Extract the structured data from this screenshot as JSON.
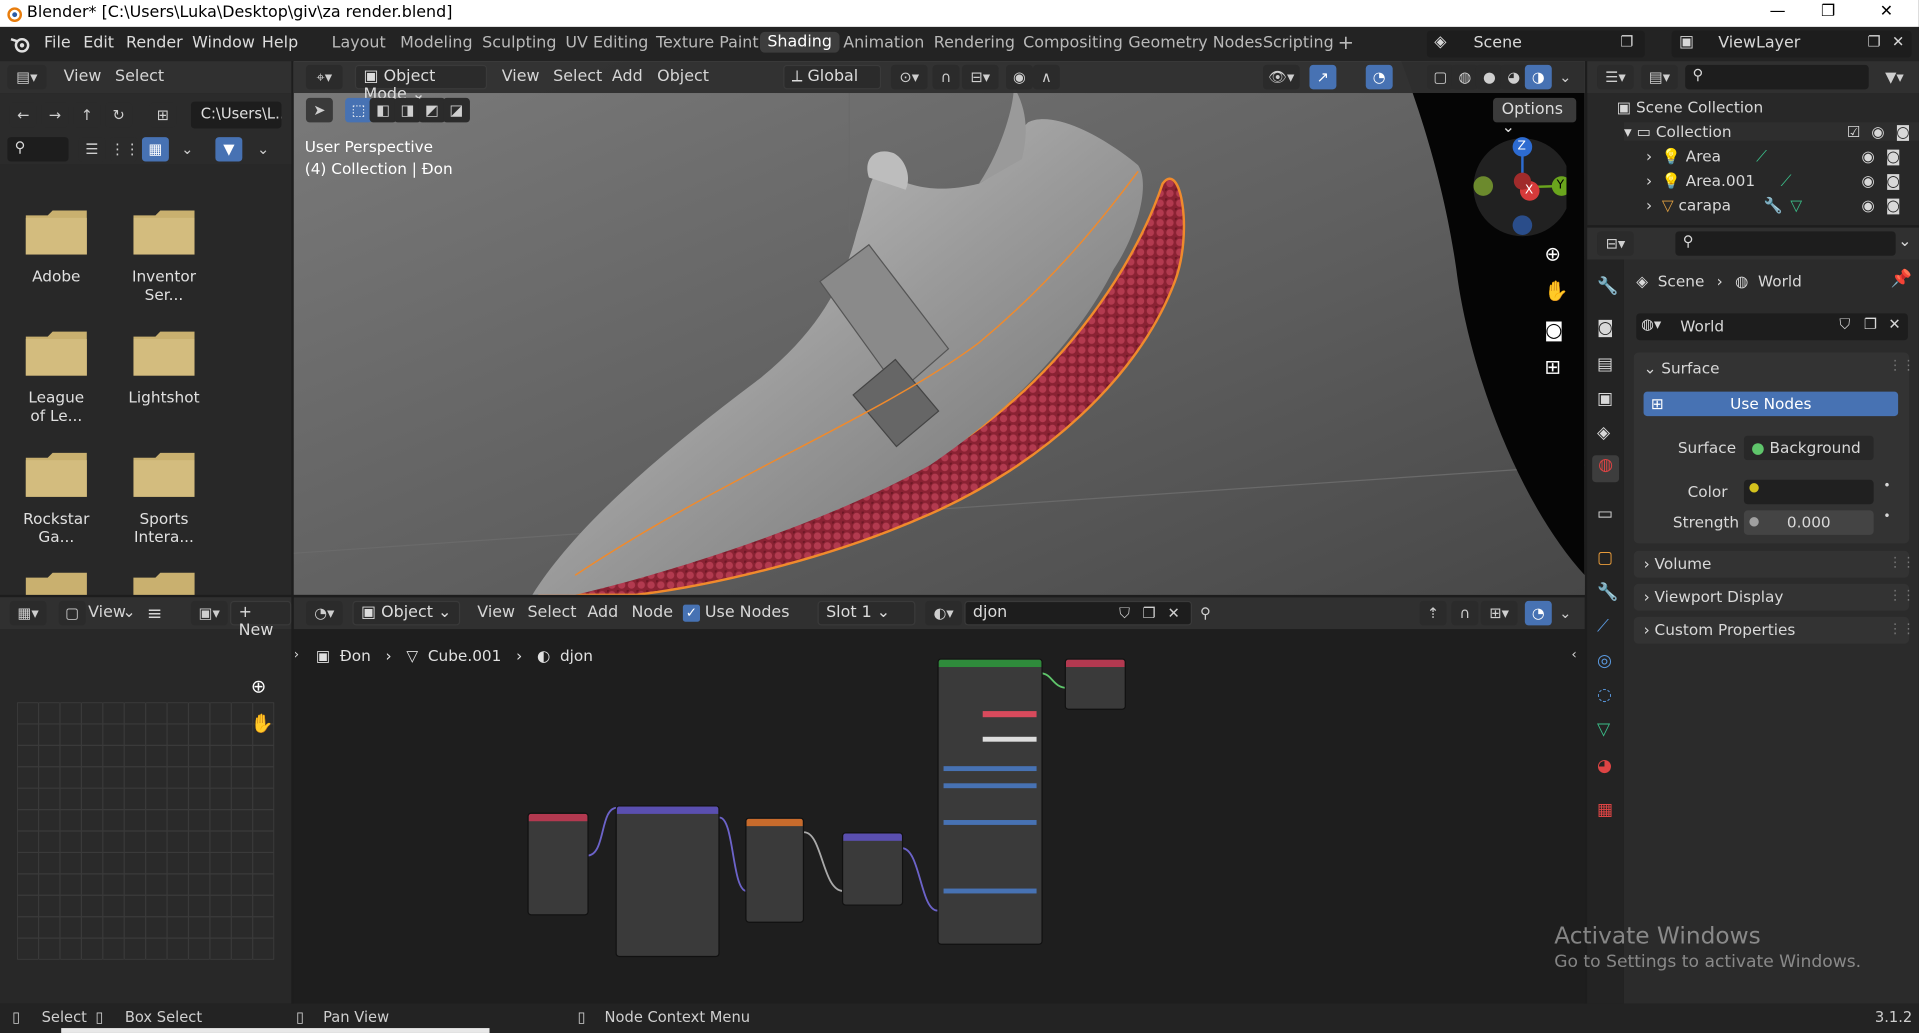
{
  "window": {
    "title": "Blender* [C:\\Users\\Luka\\Desktop\\giv\\za render.blend]",
    "min": "—",
    "max": "❐",
    "close": "✕"
  },
  "menu": [
    "File",
    "Edit",
    "Render",
    "Window",
    "Help"
  ],
  "workspaces": [
    "Layout",
    "Modeling",
    "Sculpting",
    "UV Editing",
    "Texture Paint",
    "Shading",
    "Animation",
    "Rendering",
    "Compositing",
    "Geometry Nodes",
    "Scripting"
  ],
  "active_workspace": "Shading",
  "add_workspace": "+",
  "scene": {
    "name": "Scene",
    "view_layer": "ViewLayer"
  },
  "filebrowser": {
    "header": {
      "view": "View",
      "select": "Select"
    },
    "path": "C:\\Users\\L...",
    "folders": [
      "Adobe",
      "Inventor Ser...",
      "League of Le...",
      "Lightshot",
      "Rockstar Ga...",
      "Sports Intera..."
    ]
  },
  "viewport": {
    "mode": "Object Mode",
    "menus": [
      "View",
      "Select",
      "Add",
      "Object"
    ],
    "transform": "Global",
    "options": "Options",
    "overlay_line1": "User Perspective",
    "overlay_line2": "(4) Collection | Đon",
    "gizmo": {
      "x": "X",
      "y": "Y",
      "z": "Z"
    }
  },
  "imageeditor": {
    "view": "View",
    "new": "New"
  },
  "nodeeditor": {
    "mode": "Object",
    "menus": [
      "View",
      "Select",
      "Add",
      "Node"
    ],
    "use_nodes": "Use Nodes",
    "slot": "Slot 1",
    "material": "djon",
    "breadcrumb": [
      "Đon",
      "Cube.001",
      "djon"
    ]
  },
  "outliner": {
    "scene_collection": "Scene Collection",
    "collection": "Collection",
    "items": [
      "Area",
      "Area.001",
      "carapa"
    ]
  },
  "properties": {
    "breadcrumb": [
      "Scene",
      "World"
    ],
    "world_name": "World",
    "surface_panel": "Surface",
    "use_nodes": "Use Nodes",
    "surface_label": "Surface",
    "surface_value": "Background",
    "color_label": "Color",
    "strength_label": "Strength",
    "strength_value": "0.000",
    "panels": [
      "Volume",
      "Viewport Display",
      "Custom Properties"
    ]
  },
  "watermark": {
    "line1": "Activate Windows",
    "line2": "Go to Settings to activate Windows."
  },
  "status": {
    "select": "Select",
    "box_select": "Box Select",
    "pan_view": "Pan View",
    "node_context": "Node Context Menu",
    "version": "3.1.2"
  },
  "colors": {
    "accent": "#4772b3",
    "selection_orange": "#f08a2c",
    "folder": "#c9b06f",
    "sole": "#a23344",
    "world_color": "#d4c21d"
  }
}
